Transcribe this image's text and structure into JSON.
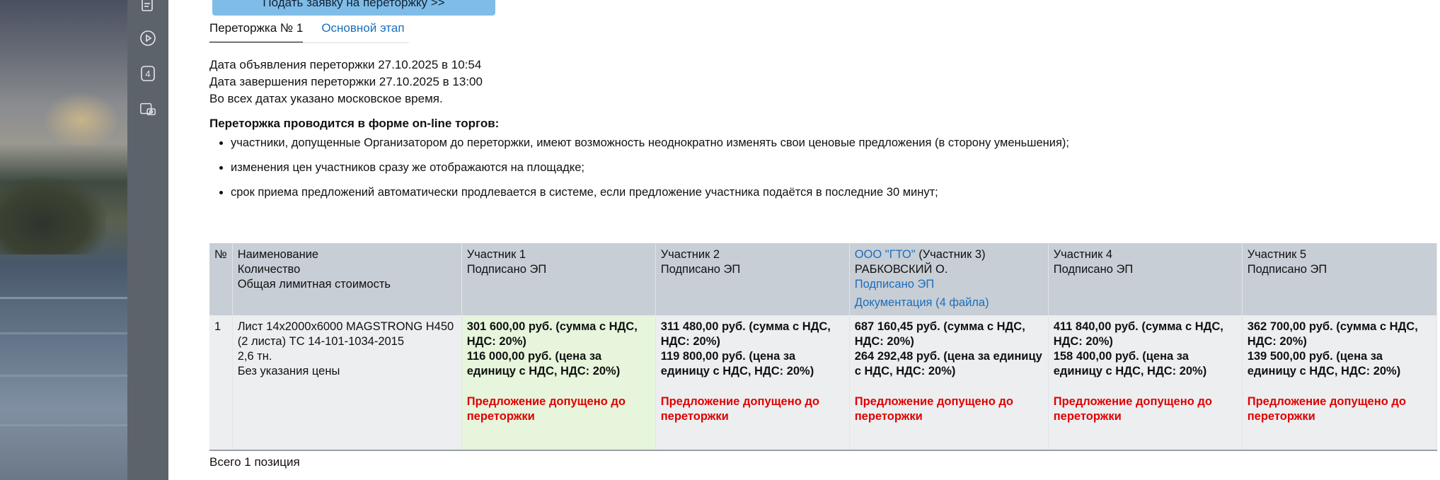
{
  "submit_button": "Подать заявку на переторжку >>",
  "tabs": [
    {
      "label": "Переторжка № 1",
      "active": true
    },
    {
      "label": "Основной этап",
      "active": false
    }
  ],
  "info": {
    "announce": "Дата объявления переторжки 27.10.2025 в 10:54",
    "end": "Дата завершения переторжки 27.10.2025 в 13:00",
    "timezone": "Во всех датах указано московское время."
  },
  "rules_title": "Переторжка проводится в форме on-line торгов:",
  "rules": [
    "участники, допущенные Организатором до переторжки, имеют возможность неоднократно изменять свои ценовые предложения (в сторону уменьшения);",
    "изменения цен участников сразу же отображаются на площадке;",
    "срок приема предложений автоматически продлевается в системе, если предложение участника подаётся в последние 30 минут;"
  ],
  "table": {
    "col_no": "№",
    "col_name": [
      "Наименование",
      "Количество",
      "Общая лимитная стоимость"
    ],
    "participants": [
      {
        "name": "Участник 1",
        "signed": "Подписано ЭП",
        "total": "301 600,00 руб. (сумма с НДС, НДС: 20%)",
        "unit": "116 000,00 руб. (цена за единицу с НДС, НДС: 20%)",
        "status": "Предложение допущено до переторжки"
      },
      {
        "name": "Участник 2",
        "signed": "Подписано ЭП",
        "total": "311 480,00 руб. (сумма с НДС, НДС: 20%)",
        "unit": "119 800,00 руб. (цена за единицу с НДС, НДС: 20%)",
        "status": "Предложение допущено до переторжки"
      },
      {
        "company": "ООО \"ГТО\"",
        "name": " (Участник 3)",
        "person": "РАБКОВСКИЙ О.",
        "signed": "Подписано ЭП",
        "docs": "Документация (4 файла)",
        "total": "687 160,45 руб. (сумма с НДС, НДС: 20%)",
        "unit": "264 292,48 руб. (цена за единицу с НДС, НДС: 20%)",
        "status": "Предложение допущено до переторжки"
      },
      {
        "name": "Участник 4",
        "signed": "Подписано ЭП",
        "total": "411 840,00 руб. (сумма с НДС, НДС: 20%)",
        "unit": "158 400,00 руб. (цена за единицу с НДС, НДС: 20%)",
        "status": "Предложение допущено до переторжки"
      },
      {
        "name": "Участник 5",
        "signed": "Подписано ЭП",
        "total": "362 700,00 руб. (сумма с НДС, НДС: 20%)",
        "unit": "139 500,00 руб. (цена за единицу с НДС, НДС: 20%)",
        "status": "Предложение допущено до переторжки"
      }
    ],
    "row": {
      "no": "1",
      "item": "Лист 14х2000х6000 MAGSTRONG Н450 (2 листа) ТС 14-101-1034-2015",
      "qty": "2,6 тн.",
      "limit": "Без указания цены"
    }
  },
  "total_positions": "Всего 1 позиция",
  "rail_icons": [
    "document-icon",
    "play-icon",
    "counter-icon",
    "camera-icon"
  ],
  "rail_counter": "4"
}
